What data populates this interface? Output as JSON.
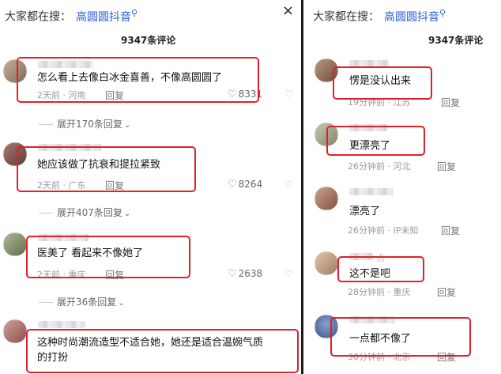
{
  "search": {
    "prefix": "大家都在搜：",
    "keyword": "高圆圆抖音"
  },
  "close_glyph": "×",
  "left": {
    "count": "9347条评论",
    "comments": [
      {
        "text": "怎么看上去像白冰金喜善，不像高圆圆了",
        "time": "2天前 · 河南",
        "reply": "回复",
        "likes": "8331",
        "avatar_color": "#a9927e",
        "expand": "展开170条回复"
      },
      {
        "text": "她应该做了抗衰和提拉紧致",
        "time": "2天前 · 广东",
        "reply": "回复",
        "likes": "8264",
        "avatar_color": "#8b5a52",
        "expand": "展开407条回复"
      },
      {
        "text": "医美了 看起来不像她了",
        "time": "2天前 · 重庆",
        "reply": "回复",
        "likes": "2638",
        "avatar_color": "#8d9a74",
        "expand": "展开36条回复"
      },
      {
        "text": "这种时尚潮流造型不适合她，她还是适合温婉气质",
        "text2": "的打扮",
        "avatar_color": "#b07a74"
      }
    ]
  },
  "right": {
    "count": "9347条评论",
    "comments": [
      {
        "text": "愣是没认出来",
        "time": "19分钟前 · 江苏",
        "reply": "回复",
        "avatar_color": "#9a7462"
      },
      {
        "text": "更漂亮了",
        "time": "26分钟前 · 河北",
        "reply": "回复",
        "avatar_color": "#9aa28a"
      },
      {
        "text": "漂亮了",
        "time": "26分钟前 · IP未知",
        "reply": "回复",
        "avatar_color": "#a37a6a"
      },
      {
        "text": "这不是吧",
        "nick_hint": "点",
        "time": "28分钟前 · 重庆",
        "reply": "回复",
        "avatar_color": "#c4a38b"
      },
      {
        "text": "一点都不像了",
        "time": "30分钟前 · 北京",
        "reply": "回复",
        "avatar_color": "#5a6f9b"
      }
    ]
  }
}
